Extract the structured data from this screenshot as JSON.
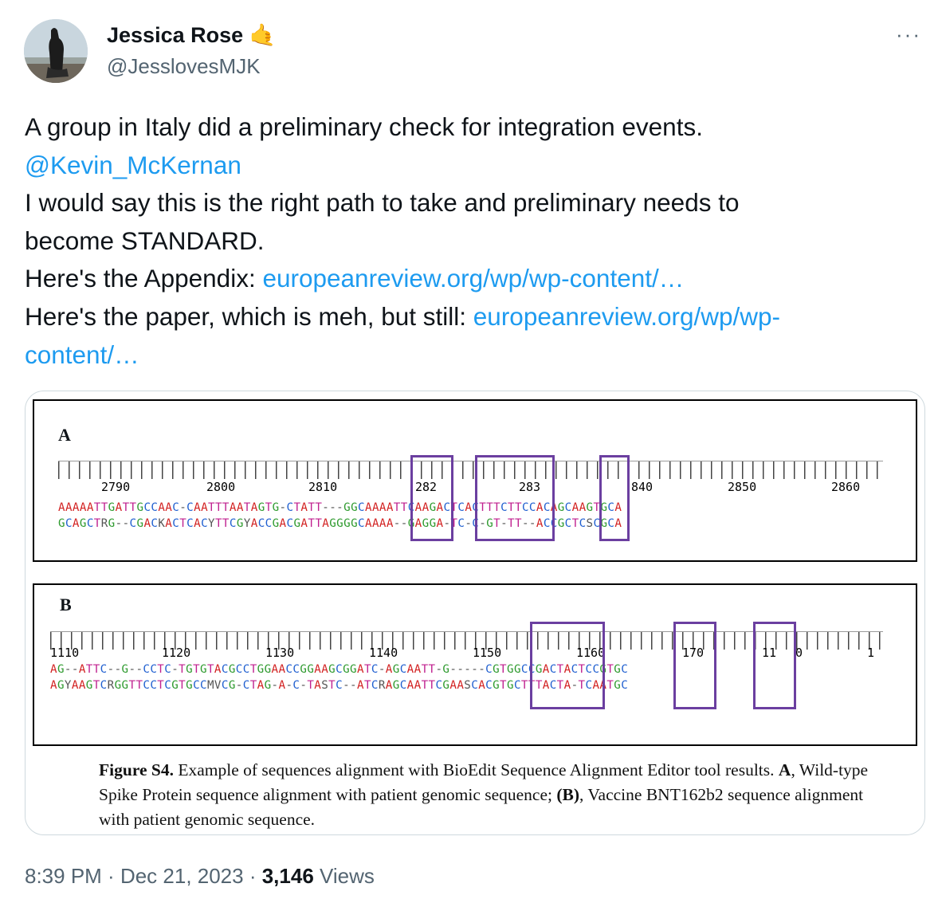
{
  "author": {
    "name": "Jessica Rose",
    "emoji": "🤙",
    "handle": "@JesslovesMJK"
  },
  "more_label": "···",
  "tweet": {
    "line1": "A group in Italy did a preliminary check for integration events.",
    "mention": "@Kevin_McKernan",
    "line3": "I would say this is the right path to take and preliminary needs to",
    "line4": "become STANDARD.",
    "appendix_prefix": "Here's the Appendix: ",
    "appendix_link": "europeanreview.org/wp/wp-content/…",
    "paper_prefix": "Here's the paper, which is meh, but still: ",
    "paper_link_1": "europeanreview.org/wp/wp-",
    "paper_link_2": "content/…"
  },
  "figure": {
    "panel_a": {
      "letter": "A",
      "ticks": [
        "2790",
        "2800",
        "2810",
        "282",
        "283",
        "840",
        "2850",
        "2860"
      ],
      "seq1": "AAAAATTGATTGCCAAC-CAATTTAATAGTG-CTATT---GGCAAAATTCAAGACTCACTTTCTTCCACAGCAAGTGCA",
      "seq2": "GCAGCTRG--CGACKACTCACYTTCGYACCGACGATTAGGGGCAAAA--GAGGA-TC-C-GT-TT--ACCGCTCSCGCA"
    },
    "panel_b": {
      "letter": "B",
      "ticks": [
        "1110",
        "1120",
        "1130",
        "1140",
        "1150",
        "1160",
        "170",
        "11",
        "0",
        "1"
      ],
      "seq1": "AG--ATTC--G--CCTC-TGTGTACGCCTGGAACCGGAAGCGGATC-AGCAATT-G-----CGTGGCCGACTACTCCGTGC",
      "seq2": "AGYAAGTCRGGTTCCTCGTGCCMVCG-CTAG-A-C-TASTC--ATCRAGCAATTCGAASCACGTGCTTTACTA-TCAATGC"
    },
    "caption": {
      "label": "Figure S4.",
      "text1": " Example of sequences alignment with BioEdit Sequence Alignment Editor tool results. ",
      "a_label": "A",
      "text2": ", Wild-type Spike Protein sequence alignment with patient genomic sequence; ",
      "b_label": "(B)",
      "text3": ", Vaccine BNT162b2 sequence alignment with patient genomic sequence."
    }
  },
  "meta": {
    "time": "8:39 PM",
    "sep1": " · ",
    "date": "Dec 21, 2023",
    "sep2": " · ",
    "views_count": "3,146",
    "views_label": " Views"
  },
  "colors": {
    "link": "#1d9bf0",
    "secondary_text": "#536471",
    "highlight_box": "#6b3fa0",
    "nuc_A": "#d22020",
    "nuc_C": "#1f5fd0",
    "nuc_G": "#2e9a2e",
    "nuc_T": "#c0208f"
  }
}
